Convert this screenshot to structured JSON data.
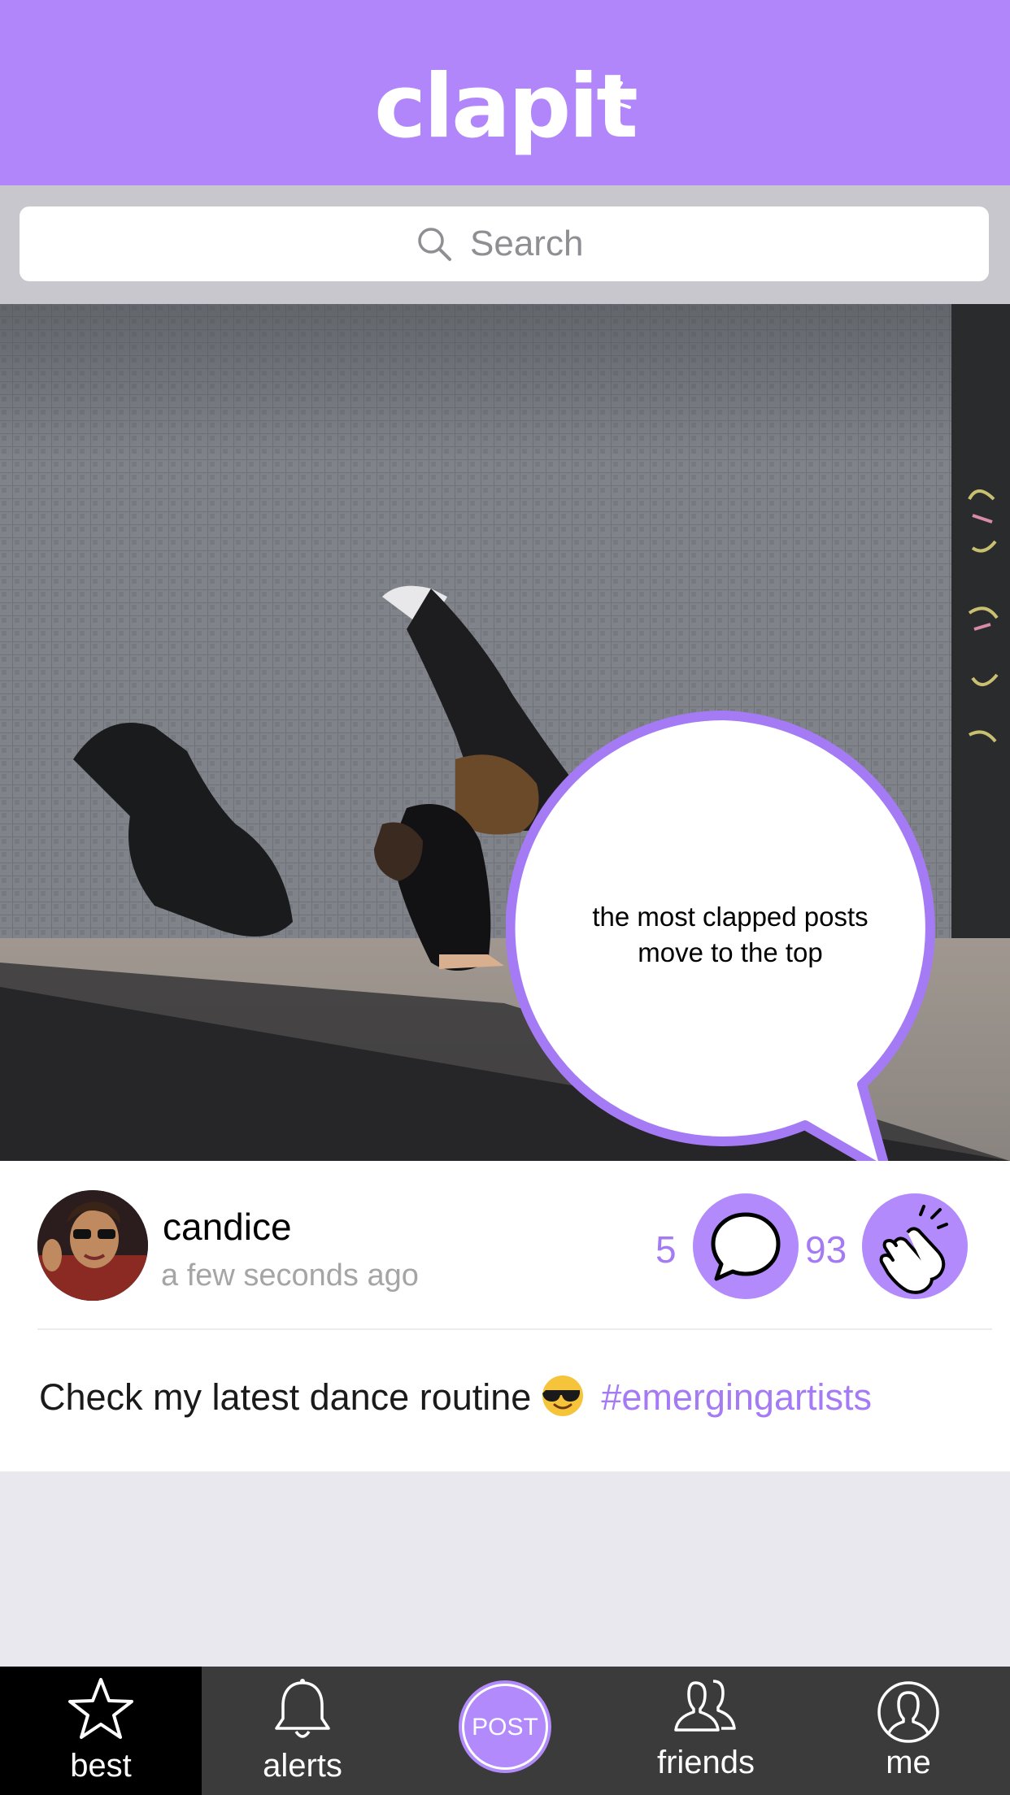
{
  "app": {
    "logo_text": "clapit",
    "brand_color": "#b286fb",
    "accent_color": "#a57af5"
  },
  "search": {
    "placeholder": "Search",
    "icon": "search-icon"
  },
  "tooltip": {
    "line1": "the most clapped posts",
    "line2": "move to the top"
  },
  "post": {
    "username": "candice",
    "timestamp": "a few seconds ago",
    "comment_count": "5",
    "clap_count": "93",
    "caption_text": "Check my latest dance routine",
    "caption_emoji": "sunglasses-emoji",
    "hashtag": "#emergingartists"
  },
  "tabbar": {
    "tabs": [
      {
        "label": "best",
        "icon": "star-icon",
        "active": true
      },
      {
        "label": "alerts",
        "icon": "bell-icon",
        "active": false
      },
      {
        "label": "POST",
        "icon": "post-button",
        "active": false
      },
      {
        "label": "friends",
        "icon": "friends-icon",
        "active": false
      },
      {
        "label": "me",
        "icon": "profile-icon",
        "active": false
      }
    ]
  }
}
